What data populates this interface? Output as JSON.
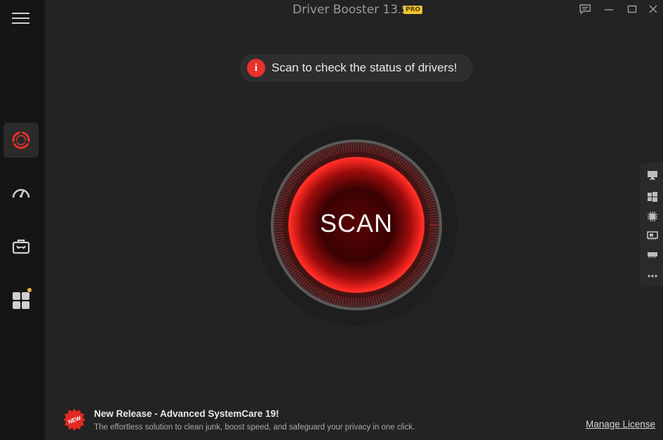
{
  "app": {
    "title": "Driver Booster 13",
    "version_suffix": ".5",
    "edition_badge": "PRO"
  },
  "notice": {
    "icon_label": "i",
    "text": "Scan to check the status of drivers!"
  },
  "scan_button": {
    "label": "SCAN"
  },
  "sidebar": {
    "items": [
      {
        "name": "driver-update",
        "icon": "driver-booster-ring-icon",
        "active": true
      },
      {
        "name": "boost",
        "icon": "speedometer-icon",
        "active": false
      },
      {
        "name": "toolbox",
        "icon": "toolbox-icon",
        "active": false
      },
      {
        "name": "action-center",
        "icon": "apps-grid-icon",
        "active": false,
        "has_notification_dot": true
      }
    ]
  },
  "device_panel": {
    "icons": [
      "monitor-icon",
      "windows-icon",
      "chip-icon",
      "network-card-icon",
      "memory-icon",
      "more-icon"
    ]
  },
  "footer": {
    "badge_text": "NEW",
    "release_title": "New Release - Advanced SystemCare 19!",
    "release_desc": "The effortless solution to clean junk, boost speed, and safeguard your privacy in one click.",
    "manage_license": "Manage License"
  },
  "colors": {
    "accent_red": "#e8312a",
    "background": "#232323",
    "sidebar": "#151515",
    "pro_badge": "#f1c232"
  }
}
